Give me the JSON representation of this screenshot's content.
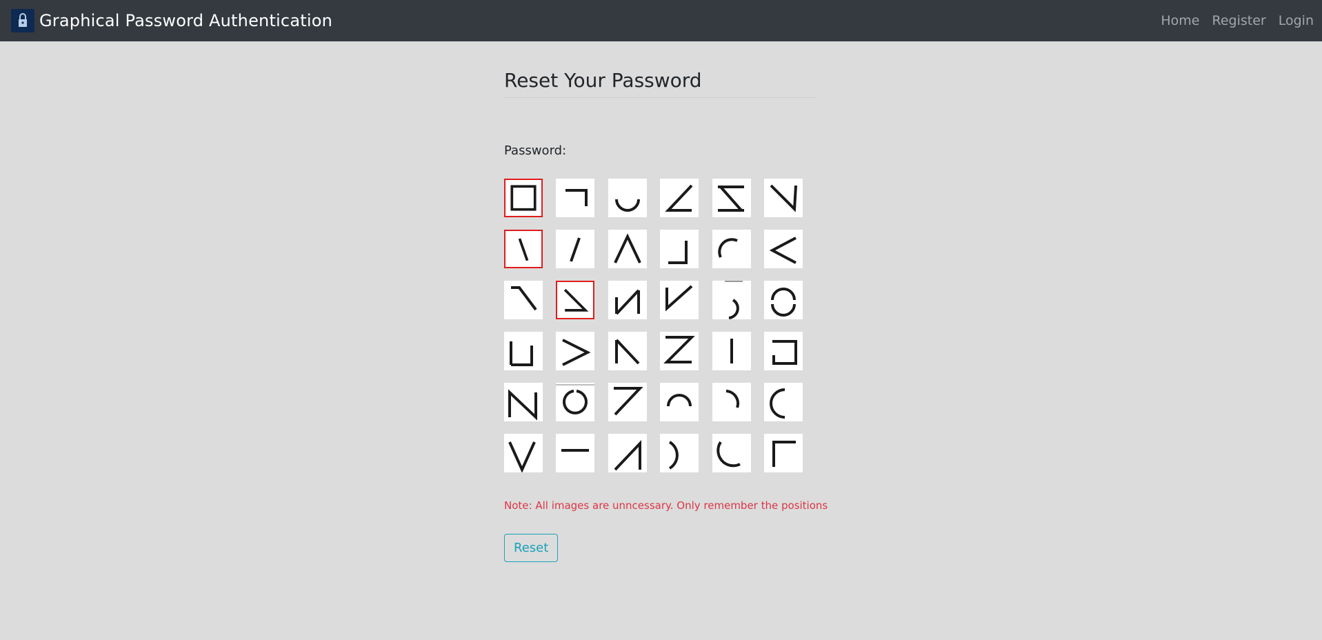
{
  "navbar": {
    "logo_icon": "lock-icon",
    "brand": "Graphical Password Authentication",
    "links": [
      "Home",
      "Register",
      "Login"
    ]
  },
  "page": {
    "title": "Reset Your Password",
    "password_label": "Password:",
    "note": "Note: All images are unncessary. Only remember the positions",
    "reset_label": "Reset"
  },
  "grid": {
    "rows": 6,
    "columns": 6,
    "tiles": [
      {
        "icon": "square-icon",
        "selected": true
      },
      {
        "icon": "corner-top-right-icon",
        "selected": false
      },
      {
        "icon": "arc-bottom-icon",
        "selected": false
      },
      {
        "icon": "angle-icon",
        "selected": false
      },
      {
        "icon": "z-reversed-icon",
        "selected": false
      },
      {
        "icon": "check-reversed-icon",
        "selected": false
      },
      {
        "icon": "backslash-icon",
        "selected": true
      },
      {
        "icon": "slash-icon",
        "selected": false
      },
      {
        "icon": "caret-up-icon",
        "selected": false
      },
      {
        "icon": "corner-bottom-right-icon",
        "selected": false
      },
      {
        "icon": "arc-top-left-icon",
        "selected": false
      },
      {
        "icon": "less-than-icon",
        "selected": false
      },
      {
        "icon": "seven-reversed-icon",
        "selected": false
      },
      {
        "icon": "triangle-open-icon",
        "selected": true
      },
      {
        "icon": "n-reversed-icon",
        "selected": false
      },
      {
        "icon": "check-tall-icon",
        "selected": false
      },
      {
        "icon": "arc-bottom-right-icon",
        "selected": false
      },
      {
        "icon": "circle-gap-icon",
        "selected": false
      },
      {
        "icon": "bracket-square-icon",
        "selected": false
      },
      {
        "icon": "greater-than-icon",
        "selected": false
      },
      {
        "icon": "k-stroke-icon",
        "selected": false
      },
      {
        "icon": "z-letter-icon",
        "selected": false
      },
      {
        "icon": "vertical-bar-icon",
        "selected": false
      },
      {
        "icon": "bracket-reversed-icon",
        "selected": false
      },
      {
        "icon": "n-letter-icon",
        "selected": false
      },
      {
        "icon": "circle-open-icon",
        "selected": false
      },
      {
        "icon": "seven-icon",
        "selected": false
      },
      {
        "icon": "arc-top-icon",
        "selected": false
      },
      {
        "icon": "arc-right-icon",
        "selected": false
      },
      {
        "icon": "arc-left-icon",
        "selected": false
      },
      {
        "icon": "v-letter-icon",
        "selected": false
      },
      {
        "icon": "dash-icon",
        "selected": false
      },
      {
        "icon": "lambda-icon",
        "selected": false
      },
      {
        "icon": "paren-right-icon",
        "selected": false
      },
      {
        "icon": "arc-bottom-left-icon",
        "selected": false
      },
      {
        "icon": "corner-top-left-icon",
        "selected": false
      }
    ]
  },
  "colors": {
    "navbar": "#343a40",
    "background": "#dcdcdc",
    "selected_border": "#e21b1b",
    "note": "#dc3545",
    "reset_button": "#17a2b8"
  }
}
